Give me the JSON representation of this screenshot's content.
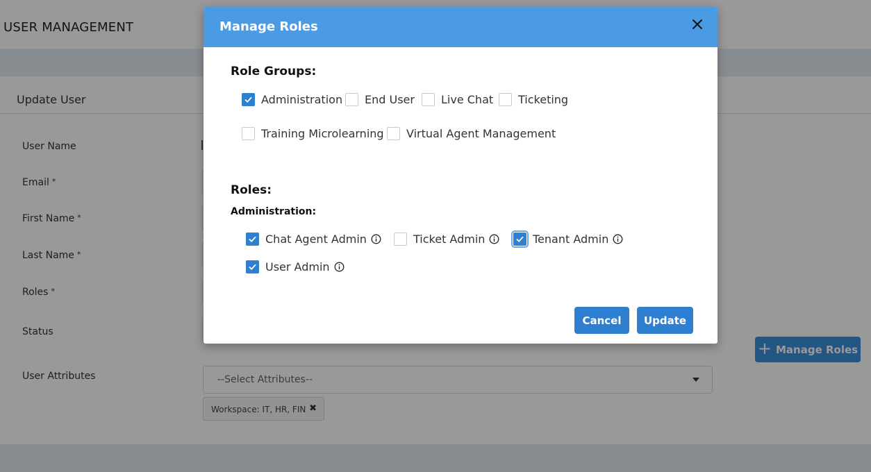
{
  "page": {
    "title": "USER MANAGEMENT",
    "section_title": "Update User",
    "fields": {
      "user_name": "User Name",
      "email": "Email",
      "first_name": "First Name",
      "last_name": "Last Name",
      "roles": "Roles",
      "status": "Status",
      "user_attributes": "User Attributes"
    },
    "required_marker": "*",
    "attributes_select": {
      "placeholder": "--Select Attributes--"
    },
    "attribute_chip": "Workspace: IT, HR, FIN",
    "manage_roles_button": "Manage Roles"
  },
  "modal": {
    "title": "Manage Roles",
    "role_groups_heading": "Role Groups:",
    "role_groups": [
      {
        "label": "Administration",
        "checked": true
      },
      {
        "label": "End User",
        "checked": false
      },
      {
        "label": "Live Chat",
        "checked": false
      },
      {
        "label": "Ticketing",
        "checked": false
      },
      {
        "label": "Training Microlearning",
        "checked": false
      },
      {
        "label": "Virtual Agent Management",
        "checked": false
      }
    ],
    "roles_heading": "Roles:",
    "roles_subheading": "Administration:",
    "roles": [
      {
        "label": "Chat Agent Admin",
        "checked": true
      },
      {
        "label": "Ticket Admin",
        "checked": false
      },
      {
        "label": "Tenant Admin",
        "checked": true,
        "focused": true
      },
      {
        "label": "User Admin",
        "checked": true
      }
    ],
    "cancel_label": "Cancel",
    "update_label": "Update"
  },
  "colors": {
    "modal_header": "#4a9ae4",
    "primary_button": "#2f7fd1",
    "checkbox_checked": "#2f80d0",
    "overlay": "rgba(0,0,0,0.4)"
  }
}
